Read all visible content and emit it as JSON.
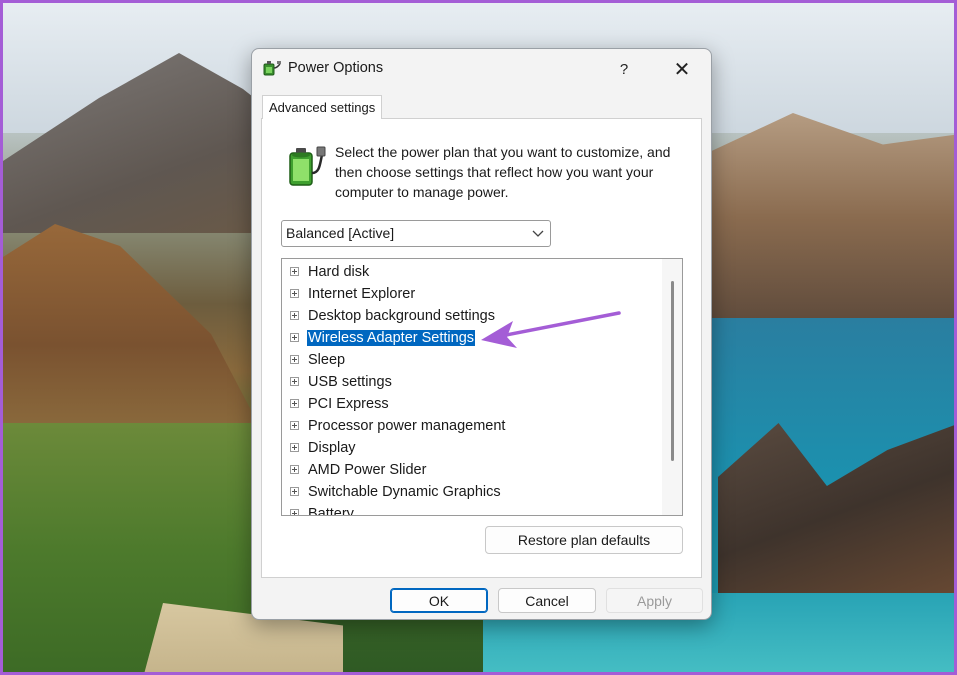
{
  "dialog": {
    "title": "Power Options",
    "help_label": "?",
    "close_label": "✕"
  },
  "tab": {
    "label": "Advanced settings"
  },
  "description": "Select the power plan that you want to customize, and then choose settings that reflect how you want your computer to manage power.",
  "plan_select": {
    "selected": "Balanced [Active]"
  },
  "settings_tree": {
    "items": [
      {
        "label": "Hard disk"
      },
      {
        "label": "Internet Explorer"
      },
      {
        "label": "Desktop background settings"
      },
      {
        "label": "Wireless Adapter Settings"
      },
      {
        "label": "Sleep"
      },
      {
        "label": "USB settings"
      },
      {
        "label": "PCI Express"
      },
      {
        "label": "Processor power management"
      },
      {
        "label": "Display"
      },
      {
        "label": "AMD Power Slider"
      },
      {
        "label": "Switchable Dynamic Graphics"
      },
      {
        "label": "Battery"
      }
    ],
    "selected_index": 3
  },
  "buttons": {
    "restore": "Restore plan defaults",
    "ok": "OK",
    "cancel": "Cancel",
    "apply": "Apply"
  },
  "colors": {
    "selection": "#0067c0",
    "annotation_arrow": "#a45dd6",
    "frame_border": "#a45dd6"
  },
  "icons": {
    "title": "power-options-icon",
    "plan": "battery-plug-icon",
    "dropdown": "chevron-down-icon",
    "expander": "tree-expand-plus-icon",
    "annotation": "arrow-icon"
  }
}
